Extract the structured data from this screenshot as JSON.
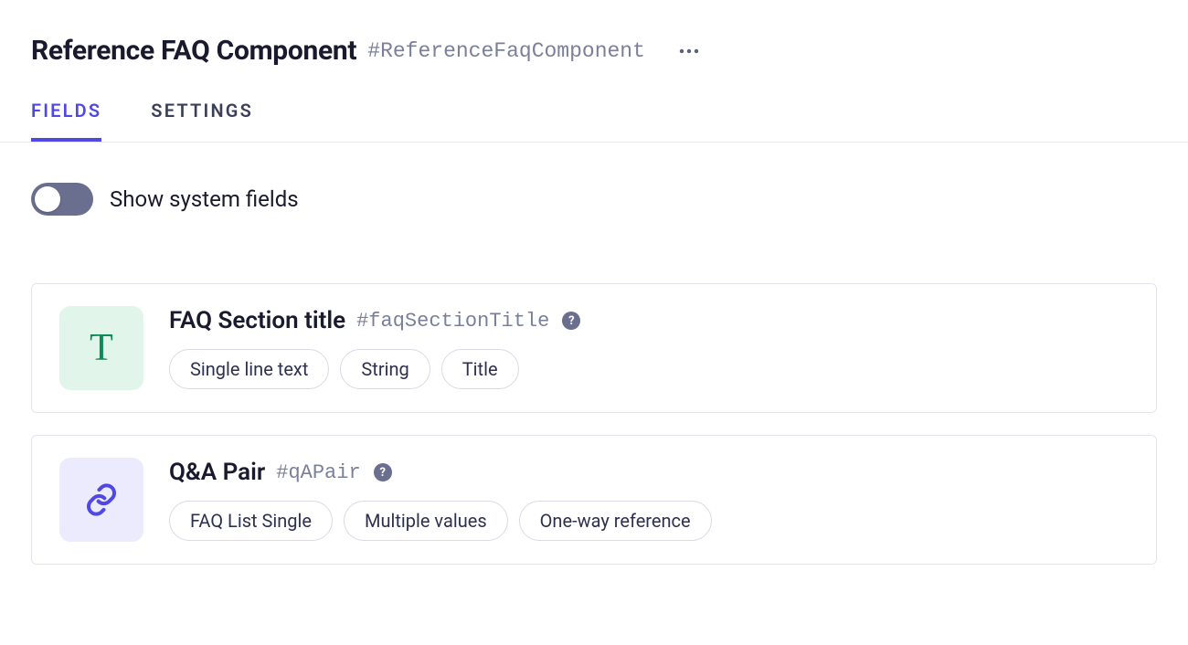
{
  "header": {
    "title": "Reference FAQ Component",
    "id": "#ReferenceFaqComponent"
  },
  "tabs": [
    {
      "label": "FIELDS",
      "active": true
    },
    {
      "label": "SETTINGS",
      "active": false
    }
  ],
  "toggle": {
    "label": "Show system fields",
    "enabled": false
  },
  "fields": [
    {
      "icon": "text",
      "title": "FAQ Section title",
      "id": "#faqSectionTitle",
      "tags": [
        "Single line text",
        "String",
        "Title"
      ]
    },
    {
      "icon": "reference",
      "title": "Q&A Pair",
      "id": "#qAPair",
      "tags": [
        "FAQ List Single",
        "Multiple values",
        "One-way reference"
      ]
    }
  ]
}
